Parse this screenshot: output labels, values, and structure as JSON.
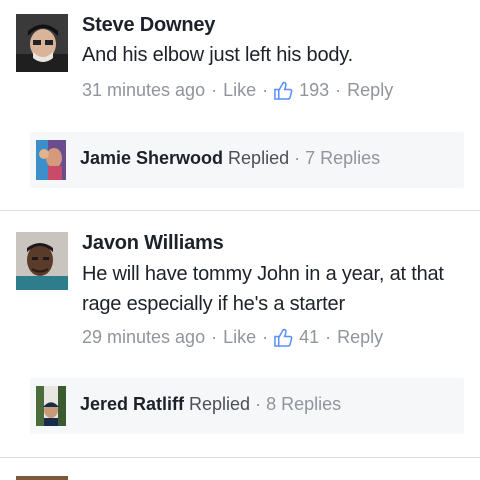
{
  "comments": [
    {
      "author": "Steve Downey",
      "text": "And his elbow just left his body.",
      "time": "31 minutes ago",
      "like_label": "Like",
      "like_count": "193",
      "reply_label": "Reply",
      "replies": {
        "author": "Jamie Sherwood",
        "replied_label": "Replied",
        "count_label": "7 Replies"
      }
    },
    {
      "author": "Javon Williams",
      "text": "He will have tommy John in a year, at that rage especially if he's a starter",
      "time": "29 minutes ago",
      "like_label": "Like",
      "like_count": "41",
      "reply_label": "Reply",
      "replies": {
        "author": "Jered Ratliff",
        "replied_label": "Replied",
        "count_label": "8 Replies"
      }
    }
  ],
  "separator": "·",
  "colors": {
    "name": "#1d2129",
    "meta": "#90949c",
    "reply_bg": "#f6f7f9",
    "divider": "#dddfe2"
  },
  "icons": [
    "thumbs-up-icon"
  ]
}
